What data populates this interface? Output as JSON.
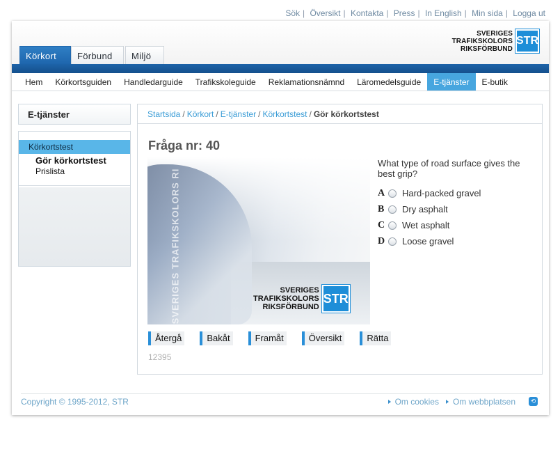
{
  "top_links": [
    "Sök",
    "Översikt",
    "Kontakta",
    "Press",
    "In English",
    "Min sida",
    "Logga ut"
  ],
  "tabs": [
    {
      "label": "Körkort",
      "active": true
    },
    {
      "label": "Förbund",
      "active": false
    },
    {
      "label": "Miljö",
      "active": false
    }
  ],
  "logo": {
    "line1": "SVERIGES",
    "line2": "TRAFIKSKOLORS",
    "line3": "RIKSFÖRBUND",
    "mark": "STR"
  },
  "nav": [
    "Hem",
    "Körkortsguiden",
    "Handledarguide",
    "Trafikskoleguide",
    "Reklamationsnämnd",
    "Läromedelsguide",
    "E-tjänster",
    "E-butik"
  ],
  "nav_active_index": 6,
  "sidebar": {
    "title": "E-tjänster",
    "items": [
      "Körkortstest",
      "Gör körkortstest",
      "Prislista"
    ]
  },
  "breadcrumb": {
    "links": [
      "Startsida",
      "Körkort",
      "E-tjänster",
      "Körkortstest"
    ],
    "current": "Gör körkortstest"
  },
  "question": {
    "title": "Fråga nr: 40",
    "text": "What type of road surface gives the best grip?",
    "answers": [
      {
        "letter": "A",
        "text": "Hard-packed gravel"
      },
      {
        "letter": "B",
        "text": "Dry asphalt"
      },
      {
        "letter": "C",
        "text": "Wet asphalt"
      },
      {
        "letter": "D",
        "text": "Loose gravel"
      }
    ],
    "image_watermark_vertical": "SVERIGES TRAFIKSKOLORS RI",
    "image_logo": {
      "line1": "SVERIGES",
      "line2": "TRAFIKSKOLORS",
      "line3": "RIKSFÖRBUND",
      "mark": "STR"
    }
  },
  "buttons": [
    "Återgå",
    "Bakåt",
    "Framåt",
    "Översikt",
    "Rätta"
  ],
  "code": "12395",
  "footer": {
    "copyright": "Copyright © 1995-2012, STR",
    "links": [
      "Om cookies",
      "Om webbplatsen"
    ]
  },
  "colors": {
    "brand_blue": "#1e66ad",
    "accent": "#47a6df",
    "link": "#3a9cd6"
  }
}
